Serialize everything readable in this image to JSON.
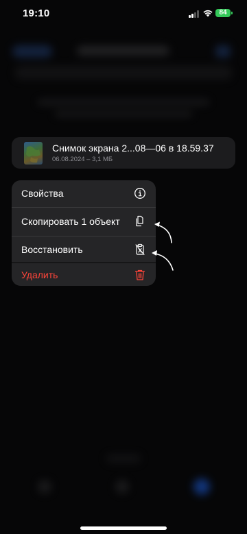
{
  "status_bar": {
    "time": "19:10",
    "battery": "84"
  },
  "file": {
    "name": "Снимок экрана 2...08—06 в 18.59.37",
    "meta": "06.08.2024 – 3,1 МБ"
  },
  "menu": {
    "items": [
      {
        "label": "Свойства",
        "icon": "info-icon"
      },
      {
        "label": "Скопировать 1 объект",
        "icon": "copy-icon"
      },
      {
        "label": "Восстановить",
        "icon": "restore-icon"
      },
      {
        "label": "Удалить",
        "icon": "trash-icon",
        "destructive": true
      }
    ]
  },
  "colors": {
    "background": "#060607",
    "menu_bg": "#252527",
    "destructive": "#ff453a",
    "battery": "#34c759",
    "accent": "#1c5bd8"
  }
}
